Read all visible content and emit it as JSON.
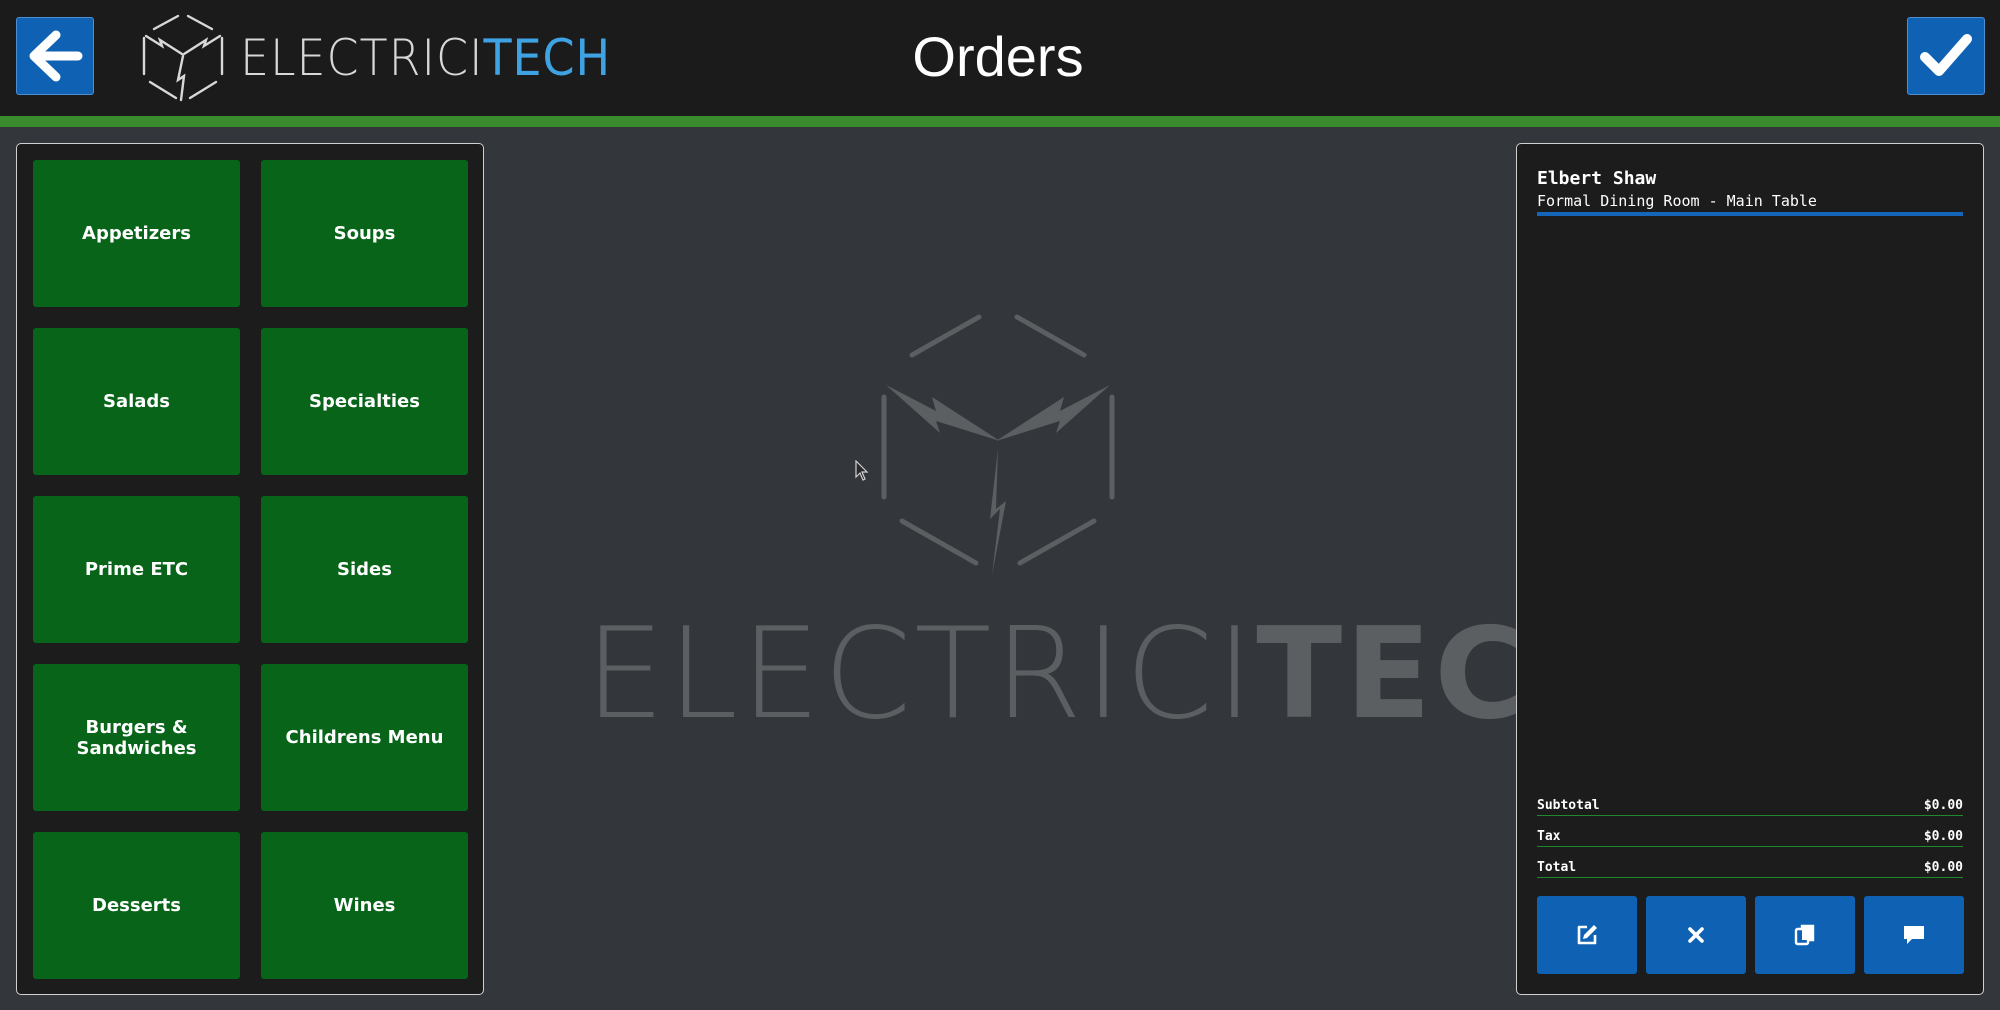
{
  "header": {
    "brand_light": "ELECTRICI",
    "brand_bold": "TECH",
    "title": "Orders",
    "back_icon": "arrow-left-icon",
    "confirm_icon": "checkmark-icon",
    "accent_color": "#3a8a2e",
    "button_color": "#0f62b3"
  },
  "categories": [
    "Appetizers",
    "Soups",
    "Salads",
    "Specialties",
    "Prime ETC",
    "Sides",
    "Burgers & Sandwiches",
    "Childrens Menu",
    "Desserts",
    "Wines"
  ],
  "watermark": {
    "light": "ELECTRICI",
    "bold": "TECH"
  },
  "order": {
    "customer_name": "Elbert Shaw",
    "location": "Formal Dining Room - Main Table",
    "totals": [
      {
        "label": "Subtotal",
        "value": "$0.00"
      },
      {
        "label": "Tax",
        "value": "$0.00"
      },
      {
        "label": "Total",
        "value": "$0.00"
      }
    ],
    "actions": [
      "edit-icon",
      "close-icon",
      "copy-icon",
      "comment-icon"
    ]
  }
}
